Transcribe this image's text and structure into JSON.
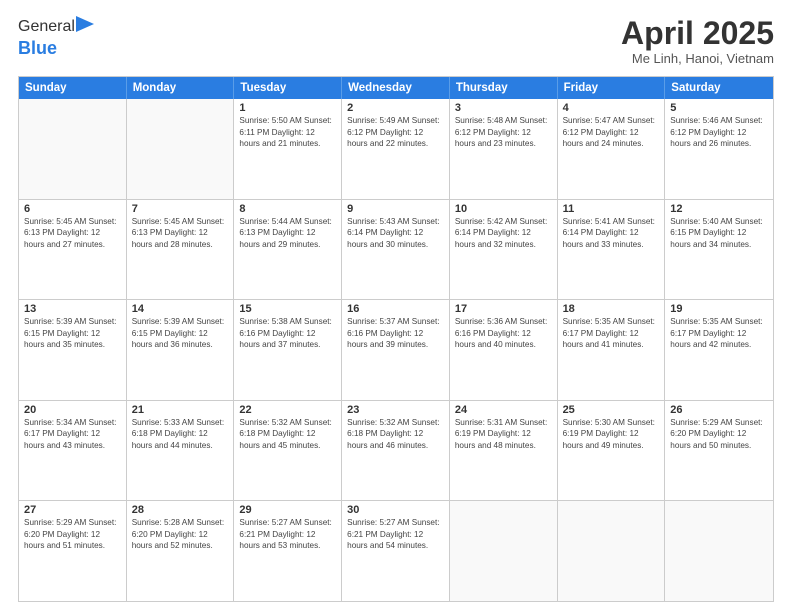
{
  "header": {
    "logo_general": "General",
    "logo_blue": "Blue",
    "month_title": "April 2025",
    "location": "Me Linh, Hanoi, Vietnam"
  },
  "calendar": {
    "days_of_week": [
      "Sunday",
      "Monday",
      "Tuesday",
      "Wednesday",
      "Thursday",
      "Friday",
      "Saturday"
    ],
    "weeks": [
      [
        {
          "day": "",
          "info": ""
        },
        {
          "day": "",
          "info": ""
        },
        {
          "day": "1",
          "info": "Sunrise: 5:50 AM\nSunset: 6:11 PM\nDaylight: 12 hours and 21 minutes."
        },
        {
          "day": "2",
          "info": "Sunrise: 5:49 AM\nSunset: 6:12 PM\nDaylight: 12 hours and 22 minutes."
        },
        {
          "day": "3",
          "info": "Sunrise: 5:48 AM\nSunset: 6:12 PM\nDaylight: 12 hours and 23 minutes."
        },
        {
          "day": "4",
          "info": "Sunrise: 5:47 AM\nSunset: 6:12 PM\nDaylight: 12 hours and 24 minutes."
        },
        {
          "day": "5",
          "info": "Sunrise: 5:46 AM\nSunset: 6:12 PM\nDaylight: 12 hours and 26 minutes."
        }
      ],
      [
        {
          "day": "6",
          "info": "Sunrise: 5:45 AM\nSunset: 6:13 PM\nDaylight: 12 hours and 27 minutes."
        },
        {
          "day": "7",
          "info": "Sunrise: 5:45 AM\nSunset: 6:13 PM\nDaylight: 12 hours and 28 minutes."
        },
        {
          "day": "8",
          "info": "Sunrise: 5:44 AM\nSunset: 6:13 PM\nDaylight: 12 hours and 29 minutes."
        },
        {
          "day": "9",
          "info": "Sunrise: 5:43 AM\nSunset: 6:14 PM\nDaylight: 12 hours and 30 minutes."
        },
        {
          "day": "10",
          "info": "Sunrise: 5:42 AM\nSunset: 6:14 PM\nDaylight: 12 hours and 32 minutes."
        },
        {
          "day": "11",
          "info": "Sunrise: 5:41 AM\nSunset: 6:14 PM\nDaylight: 12 hours and 33 minutes."
        },
        {
          "day": "12",
          "info": "Sunrise: 5:40 AM\nSunset: 6:15 PM\nDaylight: 12 hours and 34 minutes."
        }
      ],
      [
        {
          "day": "13",
          "info": "Sunrise: 5:39 AM\nSunset: 6:15 PM\nDaylight: 12 hours and 35 minutes."
        },
        {
          "day": "14",
          "info": "Sunrise: 5:39 AM\nSunset: 6:15 PM\nDaylight: 12 hours and 36 minutes."
        },
        {
          "day": "15",
          "info": "Sunrise: 5:38 AM\nSunset: 6:16 PM\nDaylight: 12 hours and 37 minutes."
        },
        {
          "day": "16",
          "info": "Sunrise: 5:37 AM\nSunset: 6:16 PM\nDaylight: 12 hours and 39 minutes."
        },
        {
          "day": "17",
          "info": "Sunrise: 5:36 AM\nSunset: 6:16 PM\nDaylight: 12 hours and 40 minutes."
        },
        {
          "day": "18",
          "info": "Sunrise: 5:35 AM\nSunset: 6:17 PM\nDaylight: 12 hours and 41 minutes."
        },
        {
          "day": "19",
          "info": "Sunrise: 5:35 AM\nSunset: 6:17 PM\nDaylight: 12 hours and 42 minutes."
        }
      ],
      [
        {
          "day": "20",
          "info": "Sunrise: 5:34 AM\nSunset: 6:17 PM\nDaylight: 12 hours and 43 minutes."
        },
        {
          "day": "21",
          "info": "Sunrise: 5:33 AM\nSunset: 6:18 PM\nDaylight: 12 hours and 44 minutes."
        },
        {
          "day": "22",
          "info": "Sunrise: 5:32 AM\nSunset: 6:18 PM\nDaylight: 12 hours and 45 minutes."
        },
        {
          "day": "23",
          "info": "Sunrise: 5:32 AM\nSunset: 6:18 PM\nDaylight: 12 hours and 46 minutes."
        },
        {
          "day": "24",
          "info": "Sunrise: 5:31 AM\nSunset: 6:19 PM\nDaylight: 12 hours and 48 minutes."
        },
        {
          "day": "25",
          "info": "Sunrise: 5:30 AM\nSunset: 6:19 PM\nDaylight: 12 hours and 49 minutes."
        },
        {
          "day": "26",
          "info": "Sunrise: 5:29 AM\nSunset: 6:20 PM\nDaylight: 12 hours and 50 minutes."
        }
      ],
      [
        {
          "day": "27",
          "info": "Sunrise: 5:29 AM\nSunset: 6:20 PM\nDaylight: 12 hours and 51 minutes."
        },
        {
          "day": "28",
          "info": "Sunrise: 5:28 AM\nSunset: 6:20 PM\nDaylight: 12 hours and 52 minutes."
        },
        {
          "day": "29",
          "info": "Sunrise: 5:27 AM\nSunset: 6:21 PM\nDaylight: 12 hours and 53 minutes."
        },
        {
          "day": "30",
          "info": "Sunrise: 5:27 AM\nSunset: 6:21 PM\nDaylight: 12 hours and 54 minutes."
        },
        {
          "day": "",
          "info": ""
        },
        {
          "day": "",
          "info": ""
        },
        {
          "day": "",
          "info": ""
        }
      ]
    ]
  }
}
